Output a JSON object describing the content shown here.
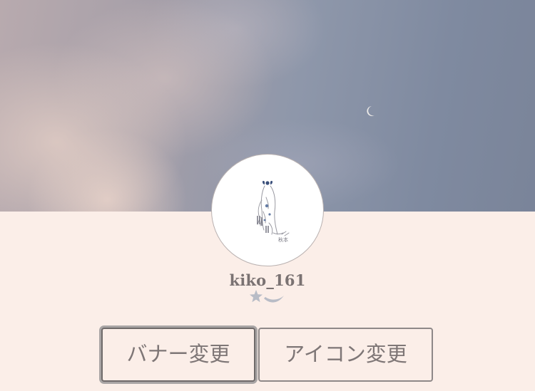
{
  "profile": {
    "username": "kiko_161"
  },
  "actions": {
    "change_banner_label": "バナー変更",
    "change_icon_label": "アイコン変更"
  },
  "icons": {
    "banner_decoration": "crescent-moon-icon",
    "badge": "star-moon-icon"
  },
  "colors": {
    "background": "#fbeee8",
    "button_border": "#8e8888",
    "text": "#7a7272"
  }
}
